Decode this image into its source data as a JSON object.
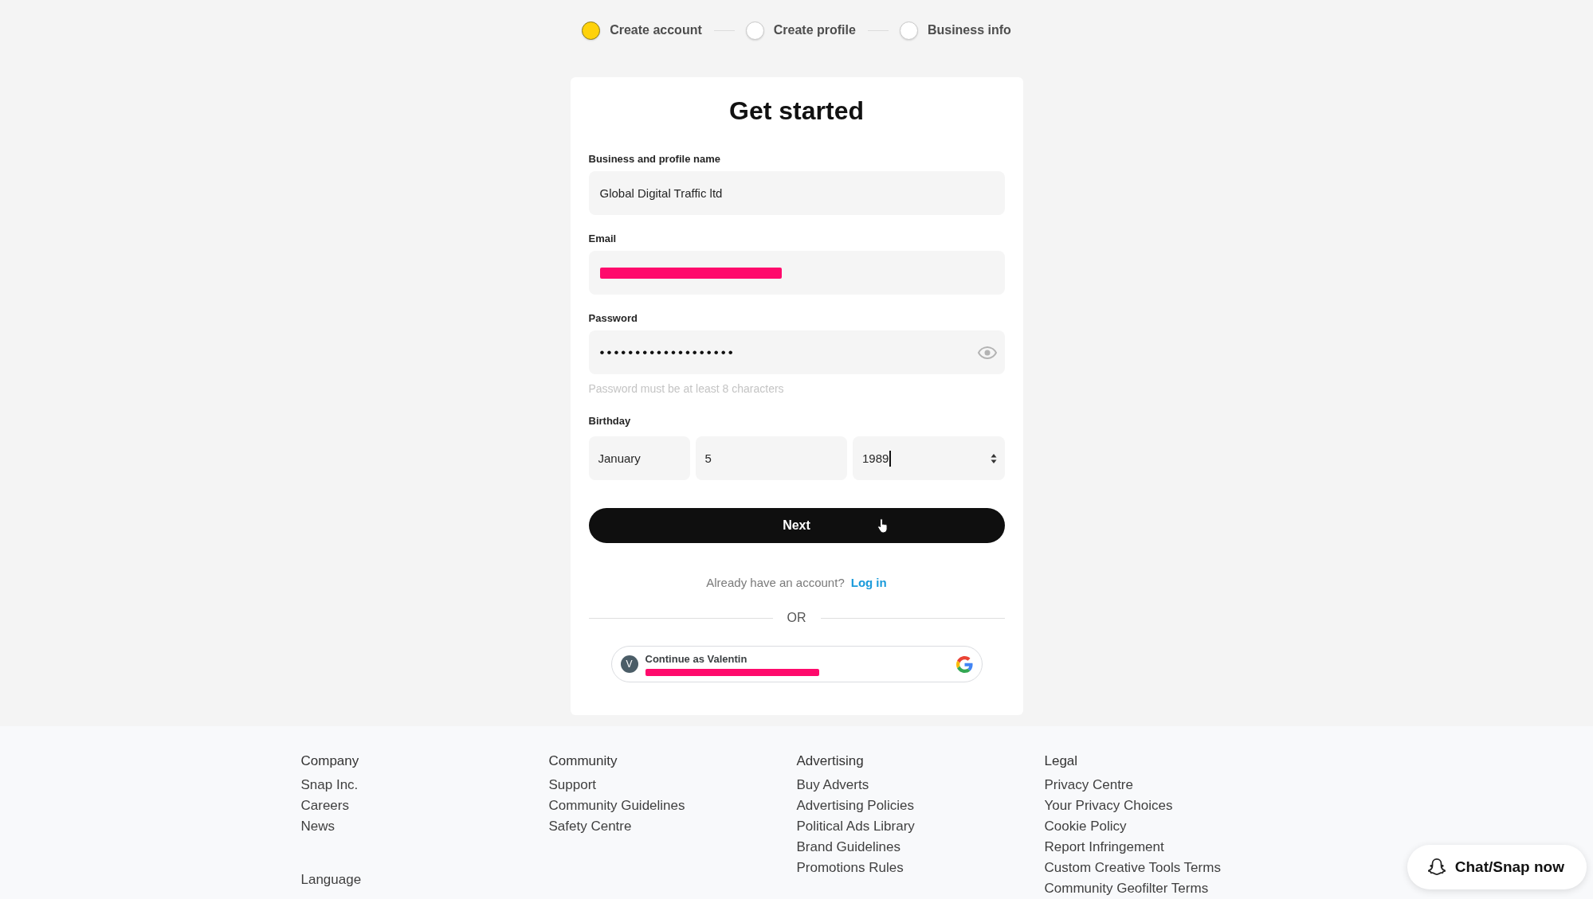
{
  "stepper": [
    {
      "label": "Create account",
      "selected": true
    },
    {
      "label": "Create profile",
      "selected": false
    },
    {
      "label": "Business info",
      "selected": false
    }
  ],
  "form": {
    "title": "Get started",
    "fields": [
      {
        "kind": "text",
        "label": "Business and profile name",
        "value": "Global Digital Traffic ltd",
        "redacted": false
      },
      {
        "kind": "email",
        "label": "Email",
        "redacted": true
      },
      {
        "kind": "password",
        "label": "Password",
        "value": "•••••••••••••••••••",
        "redacted": false,
        "hint": "Password must be at least 8 characters"
      }
    ],
    "birthday": {
      "label": "Birthday",
      "fields": [
        {
          "kind": "month",
          "value": "January",
          "focused": false
        },
        {
          "kind": "day",
          "value": "5",
          "focused": false
        },
        {
          "kind": "year",
          "value": "1989",
          "focused": true
        }
      ]
    },
    "next_button": "Next",
    "login_prompt": {
      "text": "Already have an account?",
      "link": "Log in"
    },
    "divider": "OR",
    "google_button": {
      "avatar_letter": "V",
      "label": "Continue as Valentin",
      "redacted": true
    }
  },
  "footer": {
    "columns": [
      {
        "heading": "Company",
        "links": [
          "Snap Inc.",
          "Careers",
          "News"
        ]
      },
      {
        "heading": "Community",
        "links": [
          "Support",
          "Community Guidelines",
          "Safety Centre"
        ]
      },
      {
        "heading": "Advertising",
        "links": [
          "Buy Adverts",
          "Advertising Policies",
          "Political Ads Library",
          "Brand Guidelines",
          "Promotions Rules"
        ]
      },
      {
        "heading": "Legal",
        "links": [
          "Privacy Centre",
          "Your Privacy Choices",
          "Cookie Policy",
          "Report Infringement",
          "Custom Creative Tools Terms",
          "Community Geofilter Terms"
        ]
      }
    ],
    "language": "Language"
  },
  "chat_button": "Chat/Snap now"
}
